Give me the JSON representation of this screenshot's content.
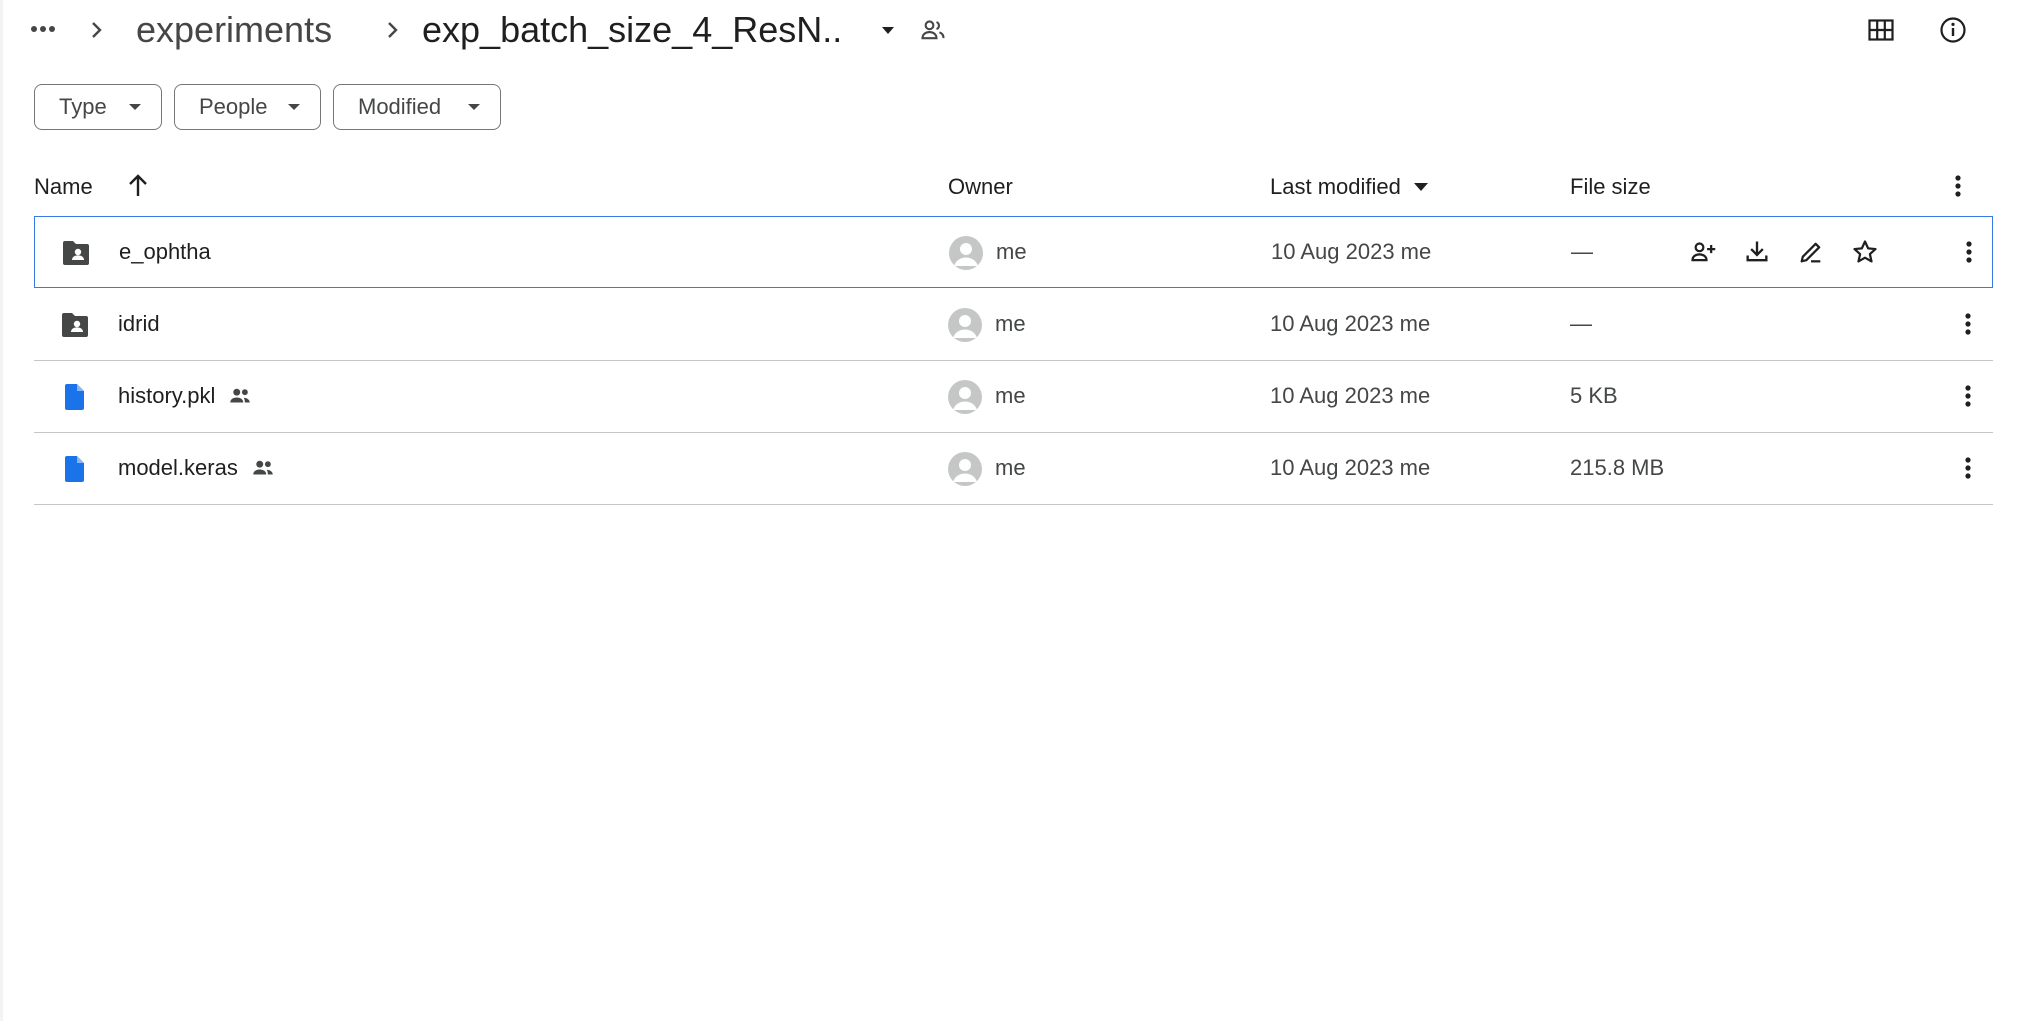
{
  "breadcrumb": {
    "parent": "experiments",
    "current": "exp_batch_size_4_ResN..."
  },
  "filters": [
    "Type",
    "People",
    "Modified"
  ],
  "columns": {
    "name": "Name",
    "owner": "Owner",
    "last_modified": "Last modified",
    "file_size": "File size"
  },
  "files": [
    {
      "name": "e_ophtha",
      "kind": "shared-folder",
      "shared": false,
      "owner": "me",
      "modified": "10 Aug 2023 me",
      "size": "—",
      "selected": true
    },
    {
      "name": "idrid",
      "kind": "shared-folder",
      "shared": false,
      "owner": "me",
      "modified": "10 Aug 2023 me",
      "size": "—",
      "selected": false
    },
    {
      "name": "history.pkl",
      "kind": "file",
      "shared": true,
      "owner": "me",
      "modified": "10 Aug 2023 me",
      "size": "5 KB",
      "selected": false
    },
    {
      "name": "model.keras",
      "kind": "file",
      "shared": true,
      "owner": "me",
      "modified": "10 Aug 2023 me",
      "size": "215.8 MB",
      "selected": false
    }
  ],
  "colors": {
    "accent": "#3b78e7",
    "folder": "#444746",
    "file": "#1a73e8",
    "divider": "#c7c7c7"
  }
}
